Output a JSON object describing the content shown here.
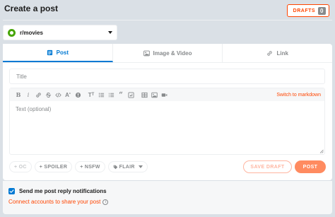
{
  "header": {
    "title": "Create a post",
    "drafts_label": "DRAFTS",
    "drafts_count": "0"
  },
  "community": {
    "name": "r/movies",
    "icon": "community-avatar-icon",
    "icon_color": "#46a508"
  },
  "tabs": [
    {
      "label": "Post",
      "icon": "document-icon",
      "active": true
    },
    {
      "label": "Image & Video",
      "icon": "image-icon",
      "active": false
    },
    {
      "label": "Link",
      "icon": "link-icon",
      "active": false
    }
  ],
  "title_input": {
    "placeholder": "Title",
    "value": ""
  },
  "editor": {
    "placeholder": "Text (optional)",
    "switch_label": "Switch to markdown",
    "toolbar": [
      "bold-icon",
      "italic-icon",
      "link-icon",
      "strikethrough-icon",
      "inline-code-icon",
      "superscript-icon",
      "spoiler-icon",
      "heading-icon",
      "bulleted-list-icon",
      "numbered-list-icon",
      "quote-block-icon",
      "code-block-icon",
      "table-icon",
      "image-icon",
      "video-icon"
    ]
  },
  "tags": {
    "oc": "+ OC",
    "spoiler": "+ SPOILER",
    "nsfw": "+ NSFW",
    "flair": "FLAIR"
  },
  "actions": {
    "save_draft": "SAVE DRAFT",
    "post": "POST"
  },
  "notifications": {
    "label": "Send me post reply notifications",
    "checked": true,
    "connect_label": "Connect accounts to share your post"
  },
  "colors": {
    "accent_blue": "#0079d3",
    "brand_orange": "#ff4500",
    "page_bg": "#dae0e6"
  }
}
